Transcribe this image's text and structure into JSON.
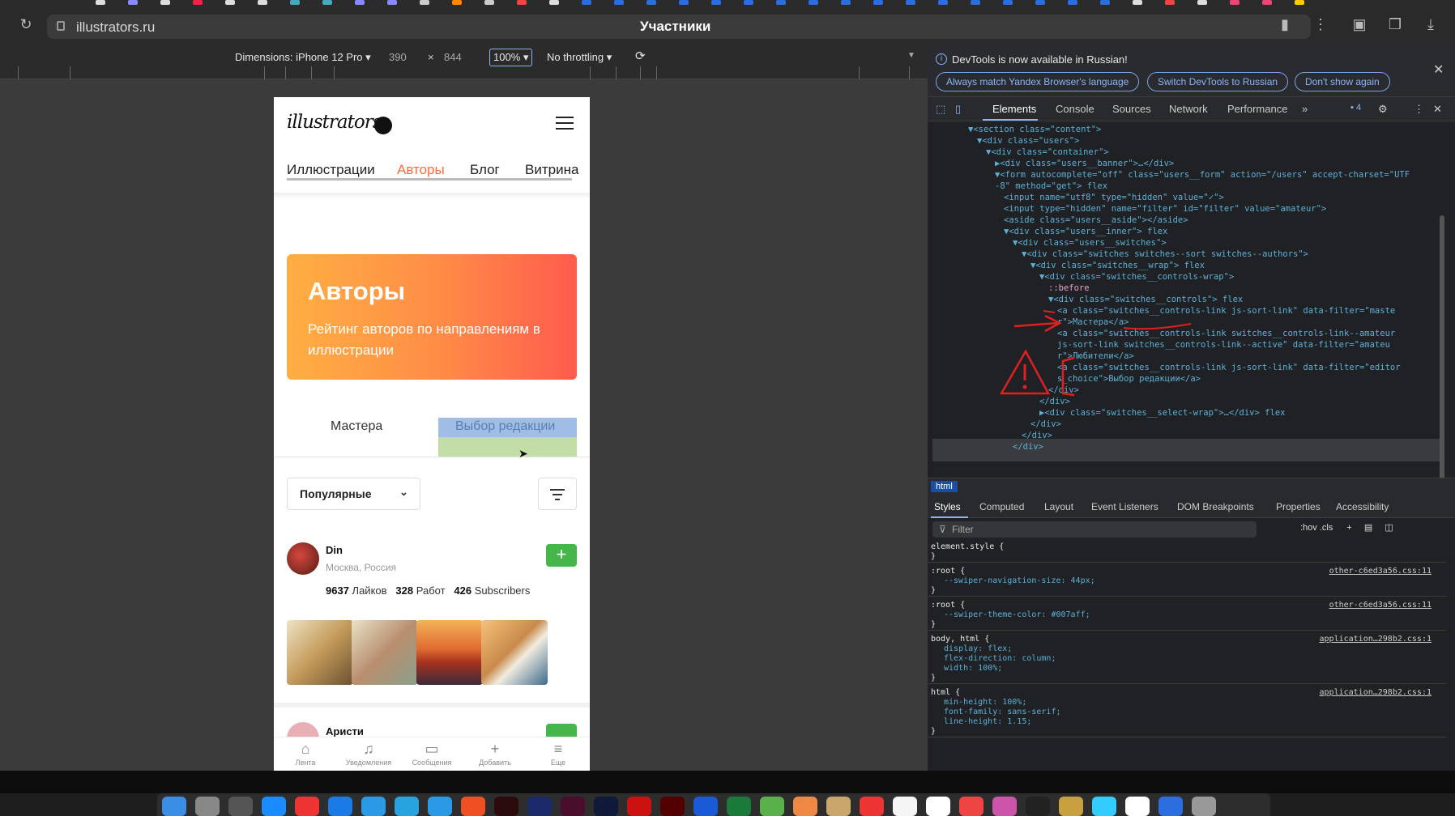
{
  "browser": {
    "url": "illustrators.ru",
    "page_title": "Участники"
  },
  "device_toolbar": {
    "dimensions_label": "Dimensions: iPhone 12 Pro",
    "width": "390",
    "times": "×",
    "height": "844",
    "zoom": "100%",
    "throttling": "No throttling"
  },
  "site": {
    "logo": "illustrators",
    "nav": [
      "Иллюстрации",
      "Авторы",
      "Блог",
      "Витрина"
    ],
    "nav_active_color": "#ff6b3d",
    "banner": {
      "title": "Авторы",
      "subtitle": "Рейтинг авторов по направлениям в иллюстрации"
    },
    "tabs": [
      "Мастера",
      "Выбор редакции"
    ],
    "sort": {
      "value": "Популярные"
    },
    "user": {
      "name": "Din",
      "city": "Москва, Россия",
      "likes_count": "9637",
      "likes_label": "Лайков",
      "works_count": "328",
      "works_label": "Работ",
      "subs_count": "426",
      "subs_label": "Subscribers"
    },
    "user2": {
      "name": "Аристи"
    },
    "bottom_nav": [
      {
        "icon": "home-icon",
        "label": "Лента"
      },
      {
        "icon": "bell-icon",
        "label": "Уведомления"
      },
      {
        "icon": "chat-icon",
        "label": "Сообщения"
      },
      {
        "icon": "plus-icon",
        "label": "Добавить"
      },
      {
        "icon": "menu-icon",
        "label": "Еще"
      }
    ],
    "add_symbol": "+"
  },
  "devtools": {
    "notice": {
      "text": "DevTools is now available in Russian!",
      "buttons": [
        "Always match Yandex Browser's language",
        "Switch DevTools to Russian",
        "Don't show again"
      ]
    },
    "tabs": [
      "Elements",
      "Console",
      "Sources",
      "Network",
      "Performance"
    ],
    "issues_count": "4",
    "dom": [
      {
        "indent": 0,
        "html": "▼<section class=\"content\">"
      },
      {
        "indent": 1,
        "html": "▼<div class=\"users\">"
      },
      {
        "indent": 2,
        "html": "▼<div class=\"container\">"
      },
      {
        "indent": 3,
        "html": "▶<div class=\"users__banner\">…</div>"
      },
      {
        "indent": 3,
        "html": "▼<form autocomplete=\"off\" class=\"users__form\" action=\"/users\" accept-charset=\"UTF"
      },
      {
        "indent": 3,
        "html": "-8\" method=\"get\"> flex"
      },
      {
        "indent": 4,
        "html": "<input name=\"utf8\" type=\"hidden\" value=\"✓\">"
      },
      {
        "indent": 4,
        "html": "<input type=\"hidden\" name=\"filter\" id=\"filter\" value=\"amateur\">"
      },
      {
        "indent": 4,
        "html": "<aside class=\"users__aside\"></aside>"
      },
      {
        "indent": 4,
        "html": "▼<div class=\"users__inner\"> flex"
      },
      {
        "indent": 5,
        "html": "▼<div class=\"users__switches\">"
      },
      {
        "indent": 6,
        "html": "▼<div class=\"switches switches--sort switches--authors\">"
      },
      {
        "indent": 7,
        "html": "▼<div class=\"switches__wrap\"> flex"
      },
      {
        "indent": 8,
        "html": "▼<div class=\"switches__controls-wrap\">"
      },
      {
        "indent": 9,
        "html": "::before"
      },
      {
        "indent": 9,
        "html": "▼<div class=\"switches__controls\"> flex"
      },
      {
        "indent": 10,
        "html": "<a class=\"switches__controls-link js-sort-link\" data-filter=\"maste"
      },
      {
        "indent": 10,
        "html": "r\">Мастера</a>"
      },
      {
        "indent": 10,
        "html": "<a class=\"switches__controls-link switches__controls-link--amateur"
      },
      {
        "indent": 10,
        "html": "js-sort-link switches__controls-link--active\" data-filter=\"amateu"
      },
      {
        "indent": 10,
        "html": "r\">Любители</a>"
      },
      {
        "indent": 10,
        "html": "<a class=\"switches__controls-link js-sort-link\" data-filter=\"editor"
      },
      {
        "indent": 10,
        "html": "s_choice\">Выбор редакции</a>"
      },
      {
        "indent": 9,
        "html": "</div>"
      },
      {
        "indent": 8,
        "html": "</div>"
      },
      {
        "indent": 8,
        "html": "▶<div class=\"switches__select-wrap\">…</div> flex"
      },
      {
        "indent": 7,
        "html": "</div>"
      },
      {
        "indent": 6,
        "html": "</div>"
      },
      {
        "indent": 5,
        "html": "</div>"
      }
    ],
    "breadcrumb": "html",
    "style_tabs": [
      "Styles",
      "Computed",
      "Layout",
      "Event Listeners",
      "DOM Breakpoints",
      "Properties",
      "Accessibility"
    ],
    "filter_placeholder": "Filter",
    "filter_tools": ":hov  .cls",
    "styles": [
      {
        "selector": "element.style {",
        "src": "",
        "props": []
      },
      {
        "selector": ":root {",
        "src": "other-c6ed3a56.css:11",
        "props": [
          "--swiper-navigation-size: 44px;"
        ]
      },
      {
        "selector": ":root {",
        "src": "other-c6ed3a56.css:11",
        "props": [
          "--swiper-theme-color: #007aff;"
        ]
      },
      {
        "selector": "body, html {",
        "src": "application…298b2.css:1",
        "props": [
          "display: flex;",
          "flex-direction: column;",
          "width: 100%;"
        ]
      },
      {
        "selector": "html {",
        "src": "application…298b2.css:1",
        "props": [
          "min-height: 100%;",
          "font-family: sans-serif;",
          "line-height: 1.15;"
        ]
      }
    ],
    "swiper_color": "#007aff"
  }
}
